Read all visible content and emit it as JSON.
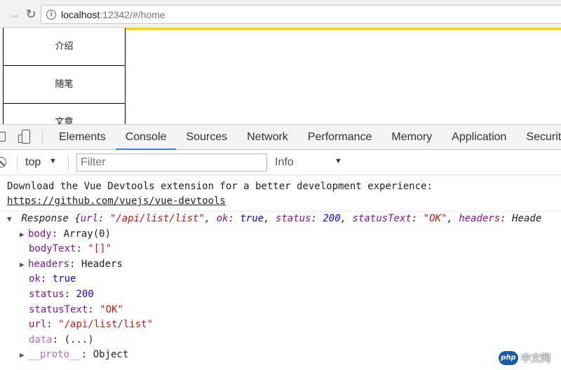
{
  "browser": {
    "url_host": "localhost",
    "url_rest": ":12342/#/home"
  },
  "page": {
    "side_nav": [
      {
        "label": "介绍"
      },
      {
        "label": "随笔"
      },
      {
        "label": "文章"
      }
    ],
    "accent_color": "#ffd400"
  },
  "devtools": {
    "tabs": [
      {
        "label": "Elements"
      },
      {
        "label": "Console"
      },
      {
        "label": "Sources"
      },
      {
        "label": "Network"
      },
      {
        "label": "Performance"
      },
      {
        "label": "Memory"
      },
      {
        "label": "Application"
      },
      {
        "label": "Security"
      }
    ],
    "active_tab": "Console",
    "context": "top",
    "filter_placeholder": "Filter",
    "level": "Info",
    "console": {
      "message_line1": "Download the Vue Devtools extension for a better development experience:",
      "message_link": "https://github.com/vuejs/vue-devtools",
      "object_preview": {
        "type": "Response",
        "open": "{",
        "url_key": "url",
        "url_val": "\"/api/list/list\"",
        "ok_key": "ok",
        "ok_val": "true",
        "status_key": "status",
        "status_val": "200",
        "statusText_key": "statusText",
        "statusText_val": "\"OK\"",
        "headers_key": "headers",
        "headers_val": "Heade"
      },
      "properties": {
        "body_key": "body",
        "body_val": "Array(0)",
        "bodyText_key": "bodyText",
        "bodyText_val": "\"[]\"",
        "headers_key": "headers",
        "headers_val": "Headers",
        "ok_key": "ok",
        "ok_val": "true",
        "status_key": "status",
        "status_val": "200",
        "statusText_key": "statusText",
        "statusText_val": "\"OK\"",
        "url_key": "url",
        "url_val": "\"/api/list/list\"",
        "data_key": "data",
        "data_val": "(...)",
        "proto_key": "__proto__",
        "proto_val": "Object"
      }
    }
  },
  "watermark": {
    "logo": "php",
    "text": "中文网"
  },
  "icons": [
    "forward-icon",
    "reload-icon",
    "info-icon",
    "inspect-icon",
    "device-toggle-icon",
    "clear-console-icon",
    "caret-down-icon",
    "expand-triangle-icon"
  ]
}
